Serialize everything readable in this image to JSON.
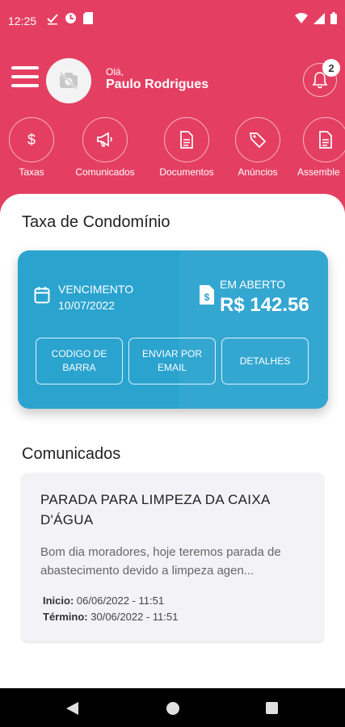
{
  "colors": {
    "brand": "#e43f63",
    "card": "#2aa3cf",
    "notice_bg": "#f3f3f7"
  },
  "status_bar": {
    "time": "12:25",
    "icons": [
      "check-icon",
      "clock-circle-icon",
      "sd-card-icon",
      "wifi-icon",
      "signal-icon",
      "battery-icon"
    ]
  },
  "header": {
    "greeting": "Olá,",
    "username": "Paulo Rodrigues",
    "notification_count": "2"
  },
  "shortcuts": [
    {
      "label": "Taxas",
      "icon": "dollar-icon"
    },
    {
      "label": "Comunicados",
      "icon": "megaphone-icon"
    },
    {
      "label": "Documentos",
      "icon": "document-icon"
    },
    {
      "label": "Anúncios",
      "icon": "tag-icon"
    },
    {
      "label": "Assemble",
      "icon": "document-icon"
    }
  ],
  "tax": {
    "section_title": "Taxa de Condomínio",
    "due_label": "VENCIMENTO",
    "due_date": "10/07/2022",
    "open_label": "EM ABERTO",
    "open_amount": "R$ 142.56",
    "buttons": [
      "CODIGO DE BARRA",
      "ENVIAR POR EMAIL",
      "DETALHES"
    ]
  },
  "notices": {
    "section_title": "Comunicados",
    "item": {
      "title": "PARADA PARA LIMPEZA DA CAIXA D'ÁGUA",
      "body": "Bom dia moradores, hoje teremos parada de abastecimento devido a limpeza agen...",
      "start_label": "Inicio:",
      "start_value": "06/06/2022 - 11:51",
      "end_label": "Término:",
      "end_value": "30/06/2022 - 11:51"
    }
  }
}
